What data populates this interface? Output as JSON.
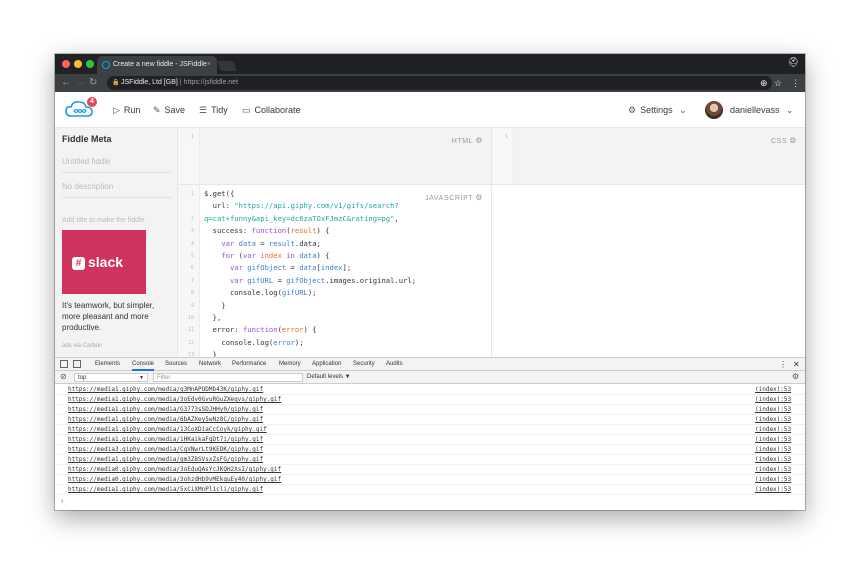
{
  "browser": {
    "tab_title": "Create a new fiddle - JSFiddle",
    "tab_close": "×",
    "site_name": "JSFiddle, Ltd [GB]",
    "url_separator": "|",
    "url": "https://jsfiddle.net"
  },
  "toolbar": {
    "run": "Run",
    "save": "Save",
    "tidy": "Tidy",
    "collaborate": "Collaborate",
    "settings": "Settings",
    "username": "daniellevass",
    "notification_count": "4"
  },
  "sidebar": {
    "title": "Fiddle Meta",
    "title_placeholder": "Untitled fiddle",
    "description_placeholder": "No description",
    "add_title_text": "Add title to make the fiddle",
    "ad_brand": "slack",
    "ad_text": "It's teamwork, but simpler, more pleasant and more productive.",
    "ad_via": "ads via Carbon"
  },
  "panels": {
    "html_label": "HTML",
    "css_label": "CSS",
    "js_label": "JAVASCRIPT",
    "html_line_numbers": [
      "1"
    ],
    "css_line_numbers": [
      "1"
    ]
  },
  "js_code": {
    "line_numbers": [
      "1",
      "",
      "2",
      "3",
      "4",
      "5",
      "6",
      "7",
      "8",
      "9",
      "10",
      "11",
      "12",
      "13"
    ],
    "lines": [
      [
        {
          "t": "$.get({",
          "c": ""
        }
      ],
      [
        {
          "t": "  url: ",
          "c": ""
        },
        {
          "t": "\"https://api.giphy.com/v1/gifs/search?",
          "c": "s"
        }
      ],
      [
        {
          "t": "q=cat+funny&api_key=dc6zaTOxFJmzC&rating=pg\"",
          "c": "s"
        },
        {
          "t": ",",
          "c": ""
        }
      ],
      [
        {
          "t": "  success: ",
          "c": ""
        },
        {
          "t": "function",
          "c": "k"
        },
        {
          "t": "(",
          "c": ""
        },
        {
          "t": "result",
          "c": "o"
        },
        {
          "t": ") {",
          "c": ""
        }
      ],
      [
        {
          "t": "    ",
          "c": ""
        },
        {
          "t": "var",
          "c": "k"
        },
        {
          "t": " data",
          "c": "f"
        },
        {
          "t": " = ",
          "c": ""
        },
        {
          "t": "result",
          "c": "f"
        },
        {
          "t": ".data;",
          "c": ""
        }
      ],
      [
        {
          "t": "    ",
          "c": ""
        },
        {
          "t": "for",
          "c": "k"
        },
        {
          "t": " (",
          "c": ""
        },
        {
          "t": "var",
          "c": "k"
        },
        {
          "t": " index",
          "c": "o"
        },
        {
          "t": " in ",
          "c": "k"
        },
        {
          "t": "data",
          "c": "f"
        },
        {
          "t": ") {",
          "c": ""
        }
      ],
      [
        {
          "t": "      ",
          "c": ""
        },
        {
          "t": "var",
          "c": "k"
        },
        {
          "t": " gifObject",
          "c": "f"
        },
        {
          "t": " = ",
          "c": ""
        },
        {
          "t": "data",
          "c": "f"
        },
        {
          "t": "[",
          "c": ""
        },
        {
          "t": "index",
          "c": "f"
        },
        {
          "t": "];",
          "c": ""
        }
      ],
      [
        {
          "t": "      ",
          "c": ""
        },
        {
          "t": "var",
          "c": "k"
        },
        {
          "t": " gifURL",
          "c": "f"
        },
        {
          "t": " = ",
          "c": ""
        },
        {
          "t": "gifObject",
          "c": "f"
        },
        {
          "t": ".images.original.url;",
          "c": ""
        }
      ],
      [
        {
          "t": "      console.log(",
          "c": ""
        },
        {
          "t": "gifURL",
          "c": "f"
        },
        {
          "t": ");",
          "c": ""
        }
      ],
      [
        {
          "t": "    }",
          "c": ""
        }
      ],
      [
        {
          "t": "  },",
          "c": ""
        }
      ],
      [
        {
          "t": "  error: ",
          "c": ""
        },
        {
          "t": "function",
          "c": "k"
        },
        {
          "t": "(",
          "c": ""
        },
        {
          "t": "error",
          "c": "o"
        },
        {
          "t": ") {",
          "c": ""
        }
      ],
      [
        {
          "t": "    console.log(",
          "c": ""
        },
        {
          "t": "error",
          "c": "f"
        },
        {
          "t": ");",
          "c": ""
        }
      ],
      [
        {
          "t": "  }",
          "c": ""
        }
      ]
    ]
  },
  "devtools": {
    "tabs": [
      "Elements",
      "Console",
      "Sources",
      "Network",
      "Performance",
      "Memory",
      "Application",
      "Security",
      "Audits"
    ],
    "active_tab": "Console",
    "context": "top",
    "filter_placeholder": "Filter",
    "levels": "Default levels ▼",
    "source": "(index):53",
    "log_lines": [
      "https://media1.giphy.com/media/q3MnAPODMb43K/giphy.gif",
      "https://media1.giphy.com/media/3oEdv0GvuRGuZXeqvs/giphy.gif",
      "https://media1.giphy.com/media/G3773sSDJHHy0/giphy.gif",
      "https://media1.giphy.com/media/6bAZXey5wNz8C/giphy.gif",
      "https://media1.giphy.com/media/13CoXDiaCcCoyk/giphy.gif",
      "https://media1.giphy.com/media/1HKaikaFqDt7i/giphy.gif",
      "https://media3.giphy.com/media/CqVNwrLt9KEDK/giphy.gif",
      "https://media1.giphy.com/media/gm3Z8SVsxZsFG/giphy.gif",
      "https://media0.giphy.com/media/3oEduQAsYcJKQH2XsI/giphy.gif",
      "https://media0.giphy.com/media/3ohzdHb9vMEkquEy40/giphy.gif",
      "https://media1.giphy.com/media/5xCiXMnPl1cli/giphy.gif"
    ]
  },
  "colors": {
    "accent": "#1a73e8",
    "brand_red": "#e4474d",
    "ad_bg": "#d1335f"
  }
}
